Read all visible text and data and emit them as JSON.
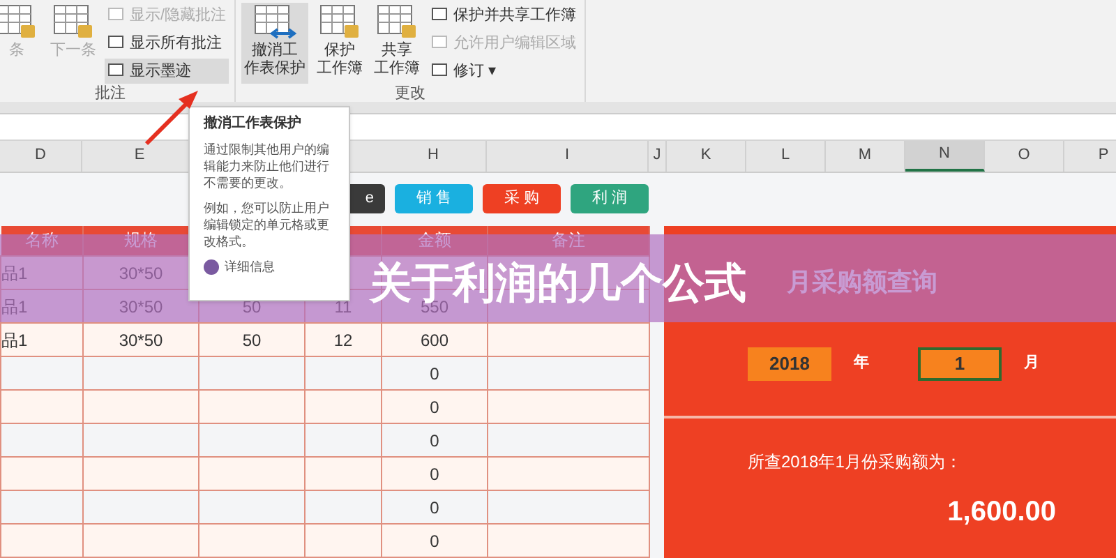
{
  "ribbon": {
    "groups": [
      {
        "label": "批注",
        "items": [
          {
            "kind": "big",
            "lines": [
              "条"
            ],
            "disabled": true,
            "selected": false
          },
          {
            "kind": "big",
            "lines": [
              "下一条"
            ],
            "disabled": true,
            "selected": false
          },
          {
            "kind": "stack",
            "children": [
              {
                "label": "显示/隐藏批注",
                "disabled": true,
                "selected": false
              },
              {
                "label": "显示所有批注",
                "disabled": false,
                "selected": false
              },
              {
                "label": "显示墨迹",
                "disabled": false,
                "selected": true
              }
            ]
          }
        ]
      },
      {
        "label": "更改",
        "items": [
          {
            "kind": "big",
            "lines": [
              "撤消工",
              "作表保护"
            ],
            "disabled": false,
            "selected": true
          },
          {
            "kind": "big",
            "lines": [
              "保护",
              "工作簿"
            ],
            "disabled": false,
            "selected": false
          },
          {
            "kind": "big",
            "lines": [
              "共享",
              "工作簿"
            ],
            "disabled": false,
            "selected": false
          },
          {
            "kind": "stack",
            "children": [
              {
                "label": "保护并共享工作簿",
                "disabled": false,
                "selected": false
              },
              {
                "label": "允许用户编辑区域",
                "disabled": true,
                "selected": false
              },
              {
                "label": "修订 ▾",
                "disabled": false,
                "selected": false
              }
            ]
          }
        ]
      }
    ]
  },
  "tooltip": {
    "title": "撤消工作表保护",
    "paragraphs": [
      "通过限制其他用户的编辑能力来防止他们进行不需要的更改。",
      "例如，您可以防止用户编辑锁定的单元格或更改格式。"
    ],
    "link": "详细信息"
  },
  "column_headers": [
    {
      "label": "D",
      "selected": false
    },
    {
      "label": "E",
      "selected": false
    },
    {
      "label": "H",
      "selected": false
    },
    {
      "label": "I",
      "selected": false
    },
    {
      "label": "J",
      "selected": false
    },
    {
      "label": "K",
      "selected": false
    },
    {
      "label": "L",
      "selected": false
    },
    {
      "label": "M",
      "selected": false
    },
    {
      "label": "N",
      "selected": true
    },
    {
      "label": "O",
      "selected": false
    },
    {
      "label": "P",
      "selected": false
    }
  ],
  "nav_buttons": [
    {
      "label": "e",
      "color": "#3a3a3a"
    },
    {
      "label": "销 售",
      "color": "#1ab0e0"
    },
    {
      "label": "采 购",
      "color": "#ee4023"
    },
    {
      "label": "利 润",
      "color": "#2fa57f"
    }
  ],
  "table": {
    "columns": [
      "名称",
      "规格",
      "",
      "",
      "金额",
      "备注"
    ],
    "rows": [
      [
        "品1",
        "30*50",
        "",
        "",
        "",
        ""
      ],
      [
        "品1",
        "30*50",
        "50",
        "11",
        "550",
        ""
      ],
      [
        "品1",
        "30*50",
        "50",
        "12",
        "600",
        ""
      ],
      [
        "",
        "",
        "",
        "",
        "0",
        ""
      ],
      [
        "",
        "",
        "",
        "",
        "0",
        ""
      ],
      [
        "",
        "",
        "",
        "",
        "0",
        ""
      ],
      [
        "",
        "",
        "",
        "",
        "0",
        ""
      ],
      [
        "",
        "",
        "",
        "",
        "0",
        ""
      ],
      [
        "",
        "",
        "",
        "",
        "0",
        ""
      ]
    ]
  },
  "query_panel": {
    "title": "月采购额查询",
    "year": "2018",
    "year_unit": "年",
    "month": "1",
    "month_unit": "月",
    "month_selected": true,
    "result_label": "所查2018年1月份采购额为：",
    "result": "1,600.00"
  },
  "banner": {
    "title": "关于利润的几个公式"
  }
}
